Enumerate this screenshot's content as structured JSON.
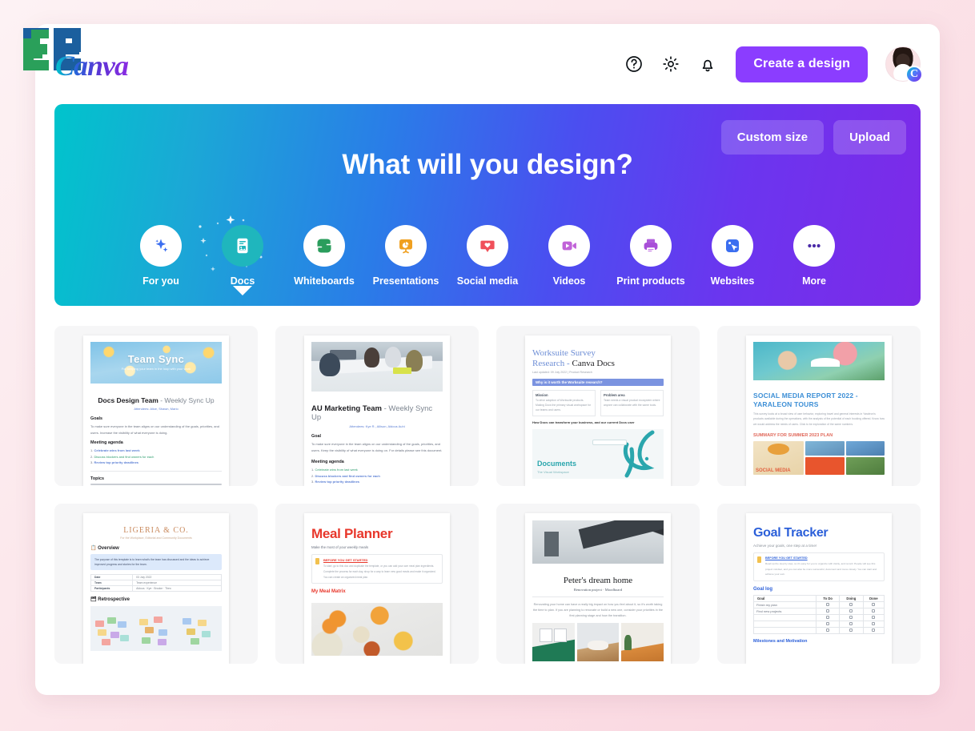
{
  "brand": {
    "name": "Canva",
    "logo_icon": "canva-logo-icon"
  },
  "header": {
    "icons": [
      {
        "name": "help-icon",
        "label": "Help"
      },
      {
        "name": "settings-gear-icon",
        "label": "Settings"
      },
      {
        "name": "notification-bell-icon",
        "label": "Notifications"
      }
    ],
    "create_button": "Create a design",
    "avatar_badge": "C",
    "accent_color": "#8b3dff"
  },
  "hero": {
    "title": "What will you design?",
    "custom_size_button": "Custom size",
    "upload_button": "Upload",
    "gradient_start": "#00c4cc",
    "gradient_end": "#7d2ae8",
    "selected_category": "Docs",
    "categories": [
      {
        "label": "For you",
        "icon": "sparkles-icon",
        "selected": false
      },
      {
        "label": "Docs",
        "icon": "document-icon",
        "selected": true
      },
      {
        "label": "Whiteboards",
        "icon": "whiteboard-icon",
        "selected": false
      },
      {
        "label": "Presentations",
        "icon": "presentation-icon",
        "selected": false
      },
      {
        "label": "Social media",
        "icon": "heart-bubble-icon",
        "selected": false
      },
      {
        "label": "Videos",
        "icon": "video-camera-icon",
        "selected": false
      },
      {
        "label": "Print products",
        "icon": "printer-icon",
        "selected": false
      },
      {
        "label": "Websites",
        "icon": "cursor-square-icon",
        "selected": false
      },
      {
        "label": "More",
        "icon": "ellipsis-icon",
        "selected": false
      }
    ]
  },
  "templates": [
    {
      "id": "team-sync",
      "banner_title": "Team Sync",
      "banner_subtitle": "For keeping your team in the loop with your work",
      "title_bold": "Docs Design Team",
      "title_light": " - Weekly Sync Up",
      "meta": "Attendees: Alice, Shawn, Mario",
      "section1": "Goals",
      "body1": "To make sure everyone in the team aligns on our understanding of the goals, priorities, and users. Increase the visibility of what everyone is doing.",
      "section2": "Meeting agenda",
      "agenda": [
        "Celebrate wins from last week",
        "Discuss blockers and find owners for each",
        "Review top priority deadlines"
      ],
      "section3": "Topics"
    },
    {
      "id": "au-marketing",
      "title_bold": "AU Marketing Team",
      "title_light": " - Weekly Sync Up",
      "meta": "Attendees: Kye R., Allison, Aldous Auhi",
      "section1": "Goal",
      "body1": "To make sure everyone in the team aligns on our understanding of the goals, priorities, and users. Keep the visibility of what everyone is doing on. For details please see this document.",
      "section2": "Meeting agenda",
      "agenda": [
        "Celebrate wins from last week",
        "Discuss blockers and find owners for each",
        "Review top priority deadlines"
      ]
    },
    {
      "id": "worksuite-survey",
      "title_line1": "Worksuite Survey",
      "title_line2": "Research - ",
      "title_brand": "Canva Docs",
      "meta": "Last updated: 09 July 2022  |  Product Research",
      "bar_label": "Why is it worth the Worksuite research?",
      "col1_head": "Mission",
      "col2_head": "Problem area",
      "col1_body": "To drive adoption of Worksuite products. Making Docs the primary visual workspace for our teams and users.",
      "col2_body": "Team needs a visual product ecosystem where anyone can collaborate with the same tools.",
      "subhead": "How Docs can transform your business, and our current Docs user",
      "image_caption": "Documents",
      "image_sub": "The Visual Workspace"
    },
    {
      "id": "social-media-report",
      "title": "SOCIAL MEDIA REPORT 2022 - YARALEON TOURS",
      "body": "This survey looks at a broad view of user behavior, exploring travel and general interests in Yaraleon's products available during the operations, with the analysis of the potential of each booking offered. Know how we would address the needs of users. Click to be exploration of the same numbers.",
      "subhead": "SUMMARY FOR SUMMER 2023 PLAN",
      "collage_label": "SOCIAL MEDIA"
    },
    {
      "id": "ligeria-co",
      "title": "LIGERIA & CO.",
      "subtitle": "For the Workplace, Editorial and Community Documents",
      "section1": "Overview",
      "note": "The purpose of this template is to learn what's the team has discussed and the ideas to achieve improved progress and stories for the team.",
      "rows": [
        {
          "key": "Date",
          "value": "03 July 2022"
        },
        {
          "key": "Team",
          "value": "Team experience"
        },
        {
          "key": "Participants",
          "value": "Aldous · Kye · Brooke · Theo"
        }
      ],
      "section2": "Retrospective"
    },
    {
      "id": "meal-planner",
      "title": "Meal Planner",
      "subtitle": "Make the most of your weekly meals",
      "note_link": "BEFORE YOU GET STARTED",
      "note_body": "To start, go to this doc and duplicate the template, or you can add your own meal plan ingredients. Complete the process for each day, shop for a way to learn new good meals and make it organized. You can create an organized meal plan.",
      "section1": "My Meal Matrix"
    },
    {
      "id": "peters-dream-home",
      "title": "Peter's dream home",
      "subtitle": "Renovation project  ·  Moodboard",
      "body": "Renovating your home can have a really big impact on how you feel about it, so it's worth taking the time to plan. If you are planning to renovate or build a new one, consider your priorities in the first planning stage and how the transition."
    },
    {
      "id": "goal-tracker",
      "title": "Goal Tracker",
      "subtitle": "Achieve your goals, one step at a time!",
      "note_link": "BEFORE YOU GET STARTED",
      "note_body": "Read up the step by step, so it's easy for you to organize with clarity, and record. People will see this project mindset, and you can also be more successful, document and move closely. You can start and achieve your own.",
      "section1": "Goal log",
      "table": {
        "headers": [
          "Goal",
          "To Do",
          "Doing",
          "Done"
        ],
        "rows": [
          {
            "goal": "Finish my plan",
            "todo": "",
            "doing": "",
            "done": ""
          },
          {
            "goal": "Find new projects",
            "todo": "",
            "doing": "",
            "done": ""
          },
          {
            "goal": "",
            "todo": "",
            "doing": "",
            "done": ""
          },
          {
            "goal": "",
            "todo": "",
            "doing": "",
            "done": ""
          },
          {
            "goal": "",
            "todo": "",
            "doing": "",
            "done": ""
          }
        ]
      },
      "section2": "Milestones and Motivation"
    }
  ]
}
